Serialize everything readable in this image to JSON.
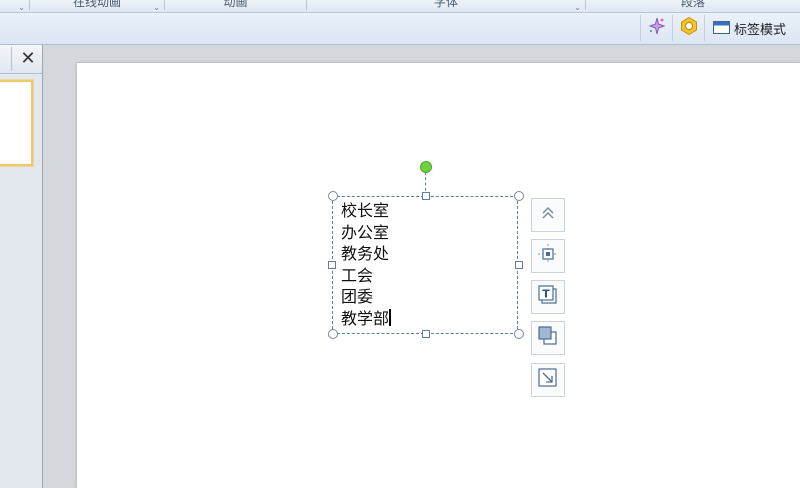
{
  "ribbon": {
    "groups": [
      {
        "label": "在线动画",
        "has_launcher": true
      },
      {
        "label": "动画",
        "has_launcher": false
      },
      {
        "label": "字体",
        "has_launcher": true
      },
      {
        "label": "段落",
        "has_launcher": false
      }
    ]
  },
  "toolbar": {
    "sparkle_icon": "sparkle-icon",
    "settings_icon": "gear-icon",
    "tag_mode_label": "标签模式"
  },
  "thumb_pane": {
    "close_icon": "close-icon"
  },
  "textbox": {
    "lines": [
      "校长室",
      "办公室",
      "教务处",
      "工会",
      "团委",
      "教学部"
    ],
    "has_caret": true
  },
  "side_buttons": [
    {
      "icon": "collapse-up-icon"
    },
    {
      "icon": "position-icon"
    },
    {
      "icon": "text-format-icon"
    },
    {
      "icon": "shape-fill-icon"
    },
    {
      "icon": "resize-icon"
    }
  ],
  "colors": {
    "selection_border": "#5f7da3",
    "rotation_handle": "#6fd13e",
    "thumb_highlight": "#f0c86a"
  }
}
